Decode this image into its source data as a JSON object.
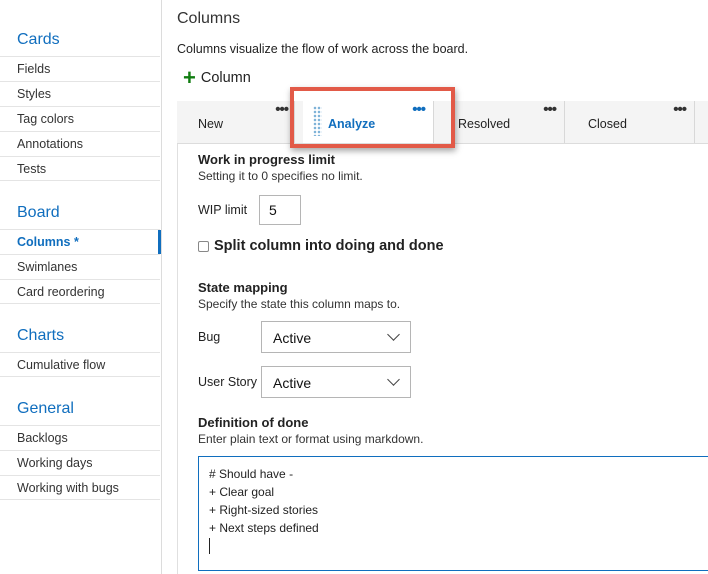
{
  "sidebar": {
    "groups": [
      {
        "title": "Cards",
        "items": [
          "Fields",
          "Styles",
          "Tag colors",
          "Annotations",
          "Tests"
        ]
      },
      {
        "title": "Board",
        "items": [
          "Columns *",
          "Swimlanes",
          "Card reordering"
        ]
      },
      {
        "title": "Charts",
        "items": [
          "Cumulative flow"
        ]
      },
      {
        "title": "General",
        "items": [
          "Backlogs",
          "Working days",
          "Working with bugs"
        ]
      }
    ],
    "active_item": "Columns *"
  },
  "main": {
    "title": "Columns",
    "description": "Columns visualize the flow of work across the board.",
    "add_column_label": "Column",
    "tabs": [
      {
        "label": "New",
        "menu": "•••"
      },
      {
        "label": "Analyze",
        "menu": "•••",
        "selected": true
      },
      {
        "label": "Resolved",
        "menu": "•••"
      },
      {
        "label": "Closed",
        "menu": "•••"
      }
    ]
  },
  "wip": {
    "title": "Work in progress limit",
    "subtitle": "Setting it to 0 specifies no limit.",
    "label": "WIP limit",
    "value": "5"
  },
  "split": {
    "label": "Split column into doing and done",
    "checked": false
  },
  "state_mapping": {
    "title": "State mapping",
    "subtitle": "Specify the state this column maps to.",
    "rows": [
      {
        "label": "Bug",
        "value": "Active"
      },
      {
        "label": "User Story",
        "value": "Active"
      }
    ]
  },
  "definition_of_done": {
    "title": "Definition of done",
    "subtitle": "Enter plain text or format using markdown.",
    "lines": [
      "# Should have -",
      "+ Clear goal",
      "+ Right-sized stories",
      "+ Next steps defined"
    ]
  },
  "colors": {
    "accent": "#106ebe",
    "add_icon": "#107c10",
    "highlight": "#e25a48"
  }
}
